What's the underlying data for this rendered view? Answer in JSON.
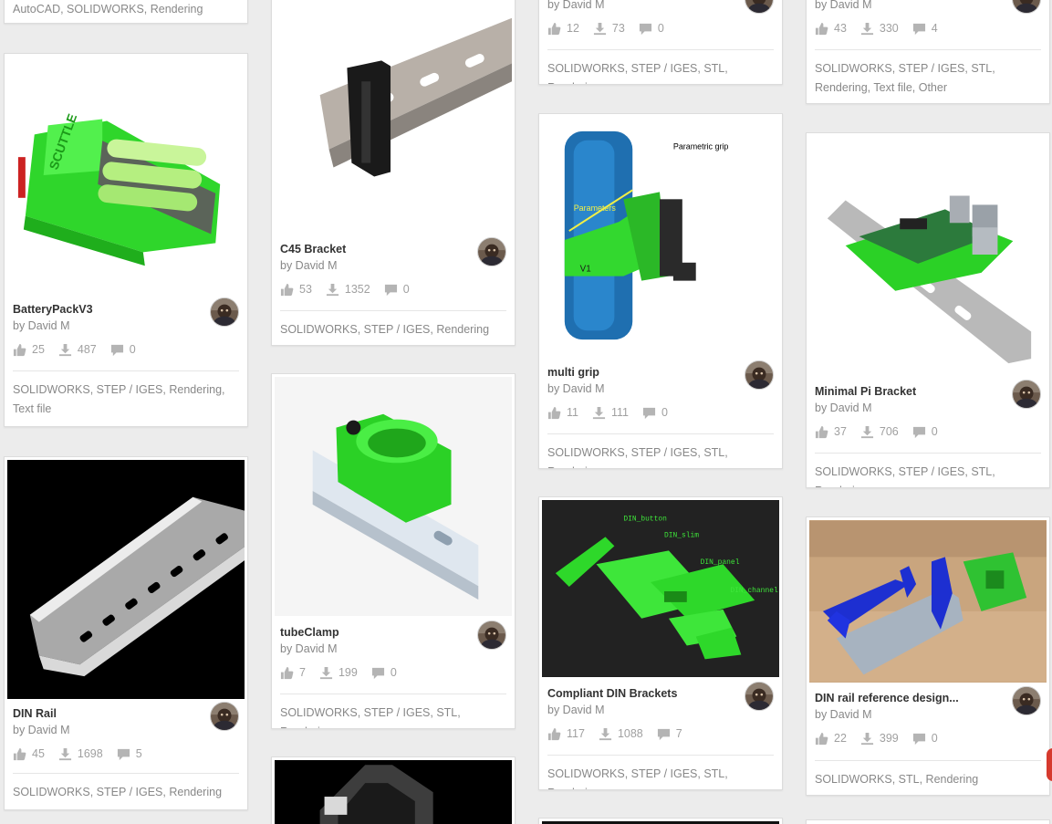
{
  "cards": {
    "c0": {
      "tags": "AutoCAD, SOLIDWORKS, Rendering"
    },
    "c1": {
      "title": "BatteryPackV3",
      "author": "by David M",
      "likes": "25",
      "downloads": "487",
      "comments": "0",
      "tags": "SOLIDWORKS, STEP / IGES, Rendering, Text file"
    },
    "c2": {
      "title": "DIN Rail",
      "author": "by David M",
      "likes": "45",
      "downloads": "1698",
      "comments": "5",
      "tags": "SOLIDWORKS, STEP / IGES, Rendering"
    },
    "c3": {
      "title": "C45 Bracket",
      "author": "by David M",
      "likes": "53",
      "downloads": "1352",
      "comments": "0",
      "tags": "SOLIDWORKS, STEP / IGES, Rendering"
    },
    "c4": {
      "title": "tubeClamp",
      "author": "by David M",
      "likes": "7",
      "downloads": "199",
      "comments": "0",
      "tags": "SOLIDWORKS, STEP / IGES, STL, Rendering"
    },
    "c6": {
      "author": "by David M",
      "likes": "12",
      "downloads": "73",
      "comments": "0",
      "tags": "SOLIDWORKS, STEP / IGES, STL, Rendering"
    },
    "c7": {
      "title": "multi grip",
      "author": "by David M",
      "likes": "11",
      "downloads": "111",
      "comments": "0",
      "tags": "SOLIDWORKS, STEP / IGES, STL, Rendering",
      "img_title": "Parametric grip",
      "img_label": "Parameters",
      "img_v": "V1"
    },
    "c8": {
      "title": "Compliant DIN Brackets",
      "author": "by David M",
      "likes": "117",
      "downloads": "1088",
      "comments": "7",
      "tags": "SOLIDWORKS, STEP / IGES, STL, Rendering",
      "img_labels": [
        "DIN_button",
        "DIN_slim",
        "DIN_panel",
        "DIN_channel"
      ]
    },
    "c10": {
      "author": "by David M",
      "likes": "43",
      "downloads": "330",
      "comments": "4",
      "tags": "SOLIDWORKS, STEP / IGES, STL, Rendering, Text file, Other"
    },
    "c11": {
      "title": "Minimal Pi Bracket",
      "author": "by David M",
      "likes": "37",
      "downloads": "706",
      "comments": "0",
      "tags": "SOLIDWORKS, STEP / IGES, STL, Rendering"
    },
    "c12": {
      "title": "DIN rail reference design...",
      "author": "by David M",
      "likes": "22",
      "downloads": "399",
      "comments": "0",
      "tags": "SOLIDWORKS, STL, Rendering"
    }
  },
  "icons": {
    "like": "thumbs-up-icon",
    "download": "download-icon",
    "comment": "comment-icon"
  },
  "colors": {
    "accent_green": "#3ee63a",
    "text_dark": "#333333",
    "text_muted": "#888888"
  }
}
